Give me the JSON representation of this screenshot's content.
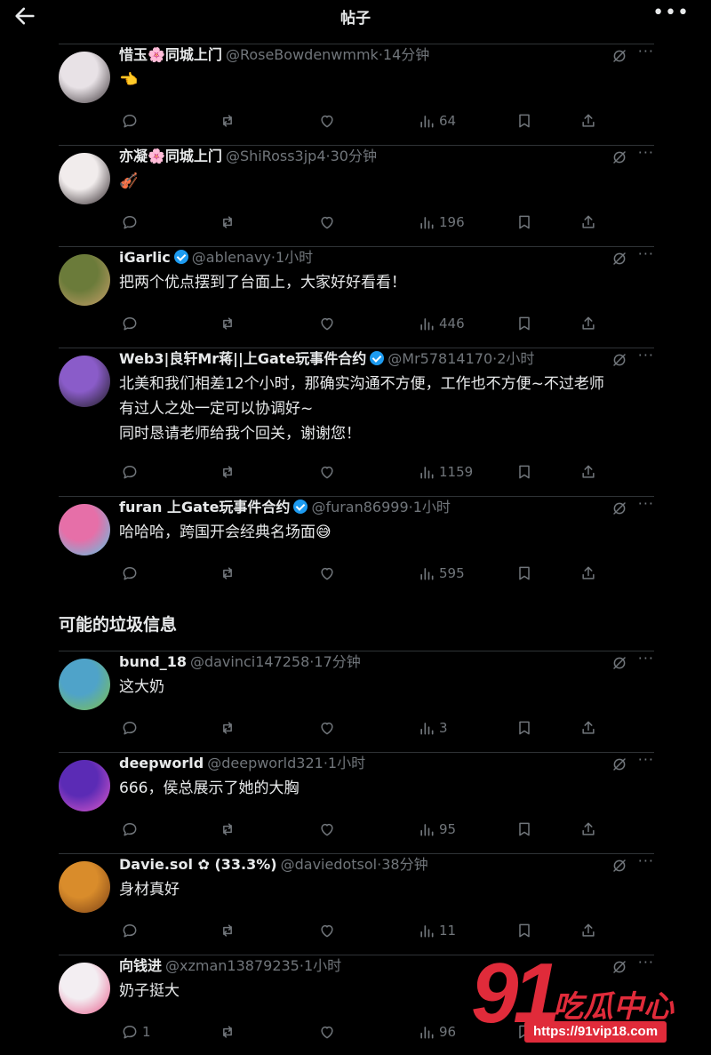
{
  "header": {
    "title": "帖子",
    "back_icon": "arrow-left-icon",
    "more_icon": "more-horizontal-icon"
  },
  "spam_section_title": "可能的垃圾信息",
  "posts": [
    {
      "name": "惜玉🌸同城上门",
      "verified": false,
      "handle": "@RoseBowdenwmmk",
      "time": "·14分钟",
      "lines": [
        "👈"
      ],
      "replies": "",
      "views": "64",
      "avatar_colors": [
        "#e8e2e6",
        "#3a3236"
      ]
    },
    {
      "name": "亦凝🌸同城上门",
      "verified": false,
      "handle": "@ShiRoss3jp4",
      "time": "·30分钟",
      "lines": [
        "🎻"
      ],
      "replies": "",
      "views": "196",
      "avatar_colors": [
        "#f1ecec",
        "#2b2226"
      ]
    },
    {
      "name": "iGarlic",
      "verified": true,
      "handle": "@ablenavy",
      "time": "·1小时",
      "lines": [
        "把两个优点摆到了台面上，大家好好看看！"
      ],
      "replies": "",
      "views": "446",
      "avatar_colors": [
        "#6b7b3a",
        "#c9a06a"
      ]
    },
    {
      "name": "Web3|良轩Mr蒋||上Gate玩事件合约",
      "verified": true,
      "handle": "@Mr57814170",
      "time": "·2小时",
      "lines": [
        "北美和我们相差12个小时，那确实沟通不方便，工作也不方便~不过老师",
        "有过人之处一定可以协调好~",
        "同时恳请老师给我个回关，谢谢您！"
      ],
      "replies": "",
      "views": "1159",
      "avatar_colors": [
        "#8a5cc9",
        "#1a1a1a"
      ]
    },
    {
      "name": "furan 上Gate玩事件合约",
      "verified": true,
      "handle": "@furan86999",
      "time": "·1小时",
      "lines": [
        "哈哈哈，跨国开会经典名场面😅"
      ],
      "replies": "",
      "views": "595",
      "avatar_colors": [
        "#e66fa8",
        "#58c7e6"
      ]
    },
    {
      "name": "bund_18",
      "verified": false,
      "handle": "@davinci147258",
      "time": "·17分钟",
      "lines": [
        "这大奶"
      ],
      "replies": "",
      "views": "3",
      "avatar_colors": [
        "#4fa3c9",
        "#7fc24a"
      ]
    },
    {
      "name": "deepworld",
      "verified": false,
      "handle": "@deepworld321",
      "time": "·1小时",
      "lines": [
        "666，侯总展示了她的大胸"
      ],
      "replies": "",
      "views": "95",
      "avatar_colors": [
        "#5b2bb5",
        "#e05acb"
      ]
    },
    {
      "name": "Davie.sol ✿ (33.3%)",
      "verified": false,
      "handle": "@daviedotsol",
      "time": "·38分钟",
      "lines": [
        "身材真好"
      ],
      "replies": "",
      "views": "11",
      "avatar_colors": [
        "#d98c2b",
        "#7a3f15"
      ]
    },
    {
      "name": "向钱进",
      "verified": false,
      "handle": "@xzman13879235",
      "time": "·1小时",
      "lines": [
        "奶子挺大"
      ],
      "replies": "1",
      "views": "96",
      "avatar_colors": [
        "#f3eef2",
        "#e85c8c"
      ]
    }
  ],
  "watermark": {
    "number": "91",
    "name": "吃瓜中心",
    "url": "https://91vip18.com"
  }
}
